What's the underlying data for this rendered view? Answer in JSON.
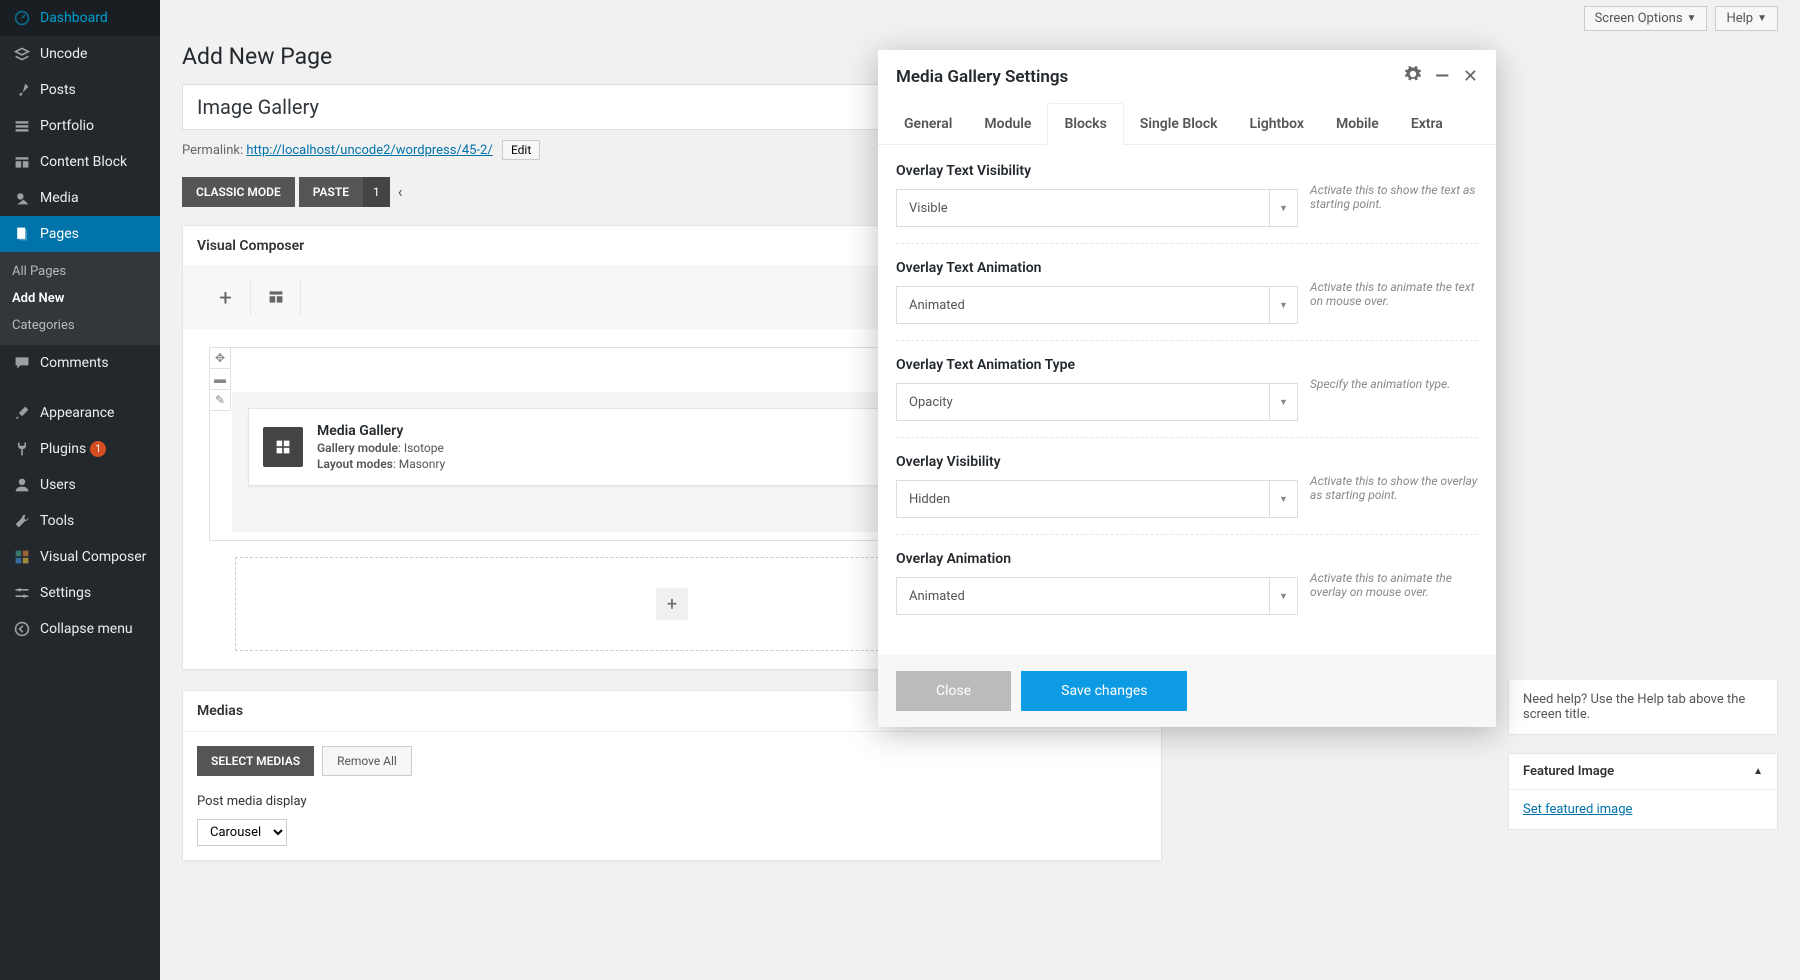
{
  "sidebar": {
    "items": [
      {
        "label": "Dashboard"
      },
      {
        "label": "Uncode"
      },
      {
        "label": "Posts"
      },
      {
        "label": "Portfolio"
      },
      {
        "label": "Content Block"
      },
      {
        "label": "Media"
      },
      {
        "label": "Pages"
      },
      {
        "label": "Comments"
      },
      {
        "label": "Appearance"
      },
      {
        "label": "Plugins",
        "badge": "1"
      },
      {
        "label": "Users"
      },
      {
        "label": "Tools"
      },
      {
        "label": "Visual Composer"
      },
      {
        "label": "Settings"
      },
      {
        "label": "Collapse menu"
      }
    ],
    "sub": [
      {
        "label": "All Pages"
      },
      {
        "label": "Add New"
      },
      {
        "label": "Categories"
      }
    ]
  },
  "toprow": {
    "screen_options": "Screen Options",
    "help": "Help"
  },
  "page": {
    "title": "Add New Page",
    "title_input": "Image Gallery"
  },
  "permalink": {
    "label": "Permalink:",
    "url": "http://localhost/uncode2/wordpress/45-2/",
    "edit": "Edit"
  },
  "modebar": {
    "classic": "CLASSIC MODE",
    "paste": "PASTE",
    "num": "1"
  },
  "vc": {
    "title": "Visual Composer",
    "widget": {
      "title": "Media Gallery",
      "line1_k": "Gallery module",
      "line1_v": ": Isotope",
      "line2_k": "Layout modes",
      "line2_v": ": Masonry"
    }
  },
  "medias": {
    "title": "Medias",
    "select_btn": "SELECT MEDIAS",
    "remove_btn": "Remove All",
    "pmd_label": "Post media display",
    "pmd_value": "Carousel"
  },
  "right": {
    "help_hint": "Need help? Use the Help tab above the screen title.",
    "featured": {
      "title": "Featured Image",
      "link": "Set featured image"
    }
  },
  "modal": {
    "title": "Media Gallery Settings",
    "tabs": [
      "General",
      "Module",
      "Blocks",
      "Single Block",
      "Lightbox",
      "Mobile",
      "Extra"
    ],
    "active_tab": "Blocks",
    "fields": [
      {
        "label": "Overlay Text Visibility",
        "value": "Visible",
        "hint": "Activate this to show the text as starting point."
      },
      {
        "label": "Overlay Text Animation",
        "value": "Animated",
        "hint": "Activate this to animate the text on mouse over."
      },
      {
        "label": "Overlay Text Animation Type",
        "value": "Opacity",
        "hint": "Specify the animation type."
      },
      {
        "label": "Overlay Visibility",
        "value": "Hidden",
        "hint": "Activate this to show the overlay as starting point."
      },
      {
        "label": "Overlay Animation",
        "value": "Animated",
        "hint": "Activate this to animate the overlay on mouse over."
      }
    ],
    "close": "Close",
    "save": "Save changes"
  }
}
